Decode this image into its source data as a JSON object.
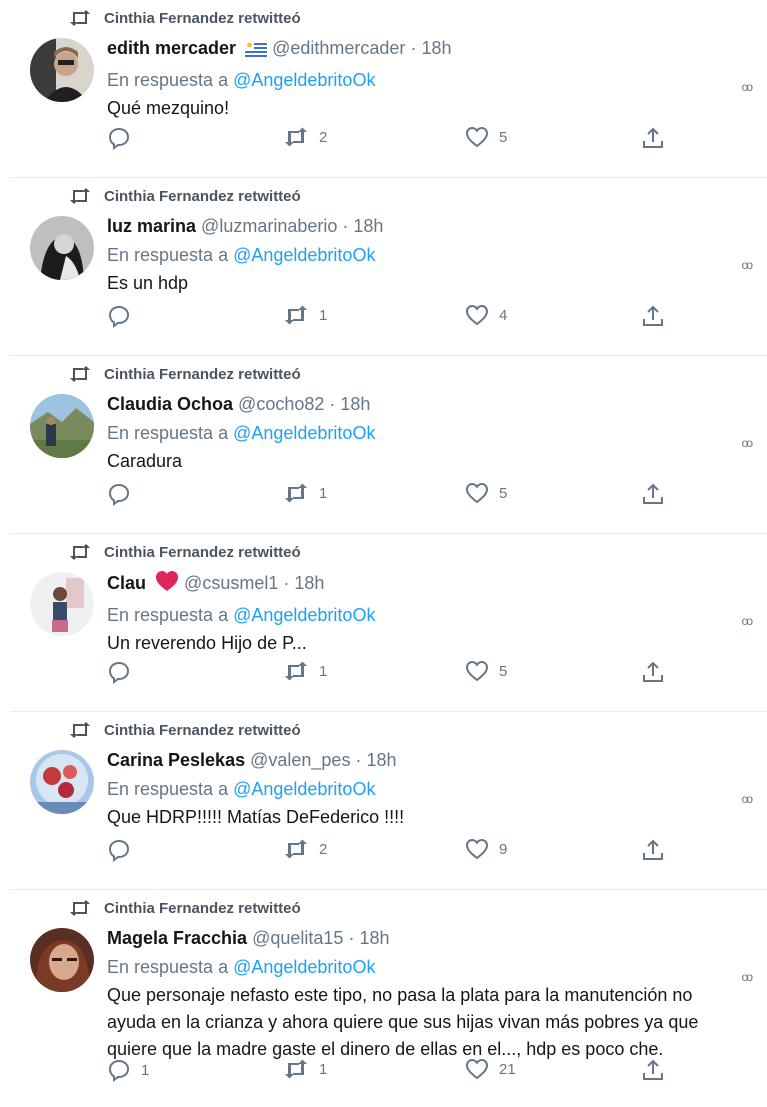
{
  "retweet_label": "Cinthia Fernandez retwitteó",
  "reply_prefix": "En respuesta a",
  "reply_mention": "@AngeldebritoOk",
  "separator": "·",
  "tweets": [
    {
      "name": "edith mercader",
      "handle": "@edithmercader",
      "time": "18h",
      "text": "Qué mezquino!",
      "replies": "",
      "retweets": "2",
      "likes": "5",
      "name_emoji": "uruguay-flag"
    },
    {
      "name": "luz marina",
      "handle": "@luzmarinaberio",
      "time": "18h",
      "text": "Es un hdp",
      "replies": "",
      "retweets": "1",
      "likes": "4"
    },
    {
      "name": "Claudia Ochoa",
      "handle": "@cocho82",
      "time": "18h",
      "text": "Caradura",
      "replies": "",
      "retweets": "1",
      "likes": "5"
    },
    {
      "name": "Clau",
      "handle": "@csusmel1",
      "time": "18h",
      "text": "Un reverendo Hijo de P...",
      "replies": "",
      "retweets": "1",
      "likes": "5",
      "name_emoji": "heart"
    },
    {
      "name": "Carina Peslekas",
      "handle": "@valen_pes",
      "time": "18h",
      "text": "Que HDRP!!!!! Matías DeFederico !!!!",
      "replies": "",
      "retweets": "2",
      "likes": "9"
    },
    {
      "name": "Magela Fracchia",
      "handle": "@quelita15",
      "time": "18h",
      "text": "Que personaje nefasto este tipo, no pasa la plata para la manutención no ayuda en la crianza y ahora quiere que sus hijas vivan más pobres ya que quiere que la madre gaste el dinero de ellas en el..., hdp es poco che.",
      "replies": "1",
      "retweets": "1",
      "likes": "21"
    }
  ],
  "colors": {
    "link": "#1da1f2",
    "muted": "#657786",
    "text": "#14171a",
    "divider": "#e6ecf0"
  },
  "icons": [
    "retweet-icon",
    "reply-icon",
    "like-icon",
    "share-icon",
    "more-icon"
  ]
}
